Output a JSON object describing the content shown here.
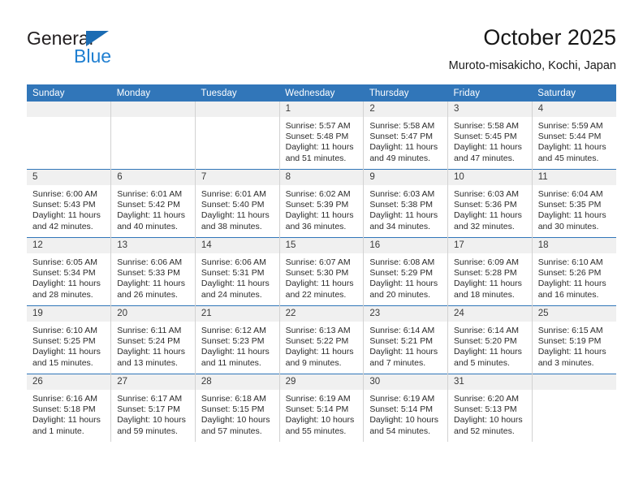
{
  "brand": {
    "name_part1": "General",
    "name_part2": "Blue",
    "triangle_color": "#1b6cb3",
    "blue_color": "#1f7fd1"
  },
  "header": {
    "title": "October 2025",
    "location": "Muroto-misakicho, Kochi, Japan"
  },
  "theme": {
    "header_bar": "#3176b9",
    "daynum_band": "#f0f0f0",
    "cell_border": "#d2d2d2"
  },
  "weekday_headers": [
    "Sunday",
    "Monday",
    "Tuesday",
    "Wednesday",
    "Thursday",
    "Friday",
    "Saturday"
  ],
  "weeks": [
    [
      {
        "day": "",
        "empty": true,
        "lines": []
      },
      {
        "day": "",
        "empty": true,
        "lines": []
      },
      {
        "day": "",
        "empty": true,
        "lines": []
      },
      {
        "day": "1",
        "lines": [
          "Sunrise: 5:57 AM",
          "Sunset: 5:48 PM",
          "Daylight: 11 hours",
          "and 51 minutes."
        ]
      },
      {
        "day": "2",
        "lines": [
          "Sunrise: 5:58 AM",
          "Sunset: 5:47 PM",
          "Daylight: 11 hours",
          "and 49 minutes."
        ]
      },
      {
        "day": "3",
        "lines": [
          "Sunrise: 5:58 AM",
          "Sunset: 5:45 PM",
          "Daylight: 11 hours",
          "and 47 minutes."
        ]
      },
      {
        "day": "4",
        "lines": [
          "Sunrise: 5:59 AM",
          "Sunset: 5:44 PM",
          "Daylight: 11 hours",
          "and 45 minutes."
        ]
      }
    ],
    [
      {
        "day": "5",
        "lines": [
          "Sunrise: 6:00 AM",
          "Sunset: 5:43 PM",
          "Daylight: 11 hours",
          "and 42 minutes."
        ]
      },
      {
        "day": "6",
        "lines": [
          "Sunrise: 6:01 AM",
          "Sunset: 5:42 PM",
          "Daylight: 11 hours",
          "and 40 minutes."
        ]
      },
      {
        "day": "7",
        "lines": [
          "Sunrise: 6:01 AM",
          "Sunset: 5:40 PM",
          "Daylight: 11 hours",
          "and 38 minutes."
        ]
      },
      {
        "day": "8",
        "lines": [
          "Sunrise: 6:02 AM",
          "Sunset: 5:39 PM",
          "Daylight: 11 hours",
          "and 36 minutes."
        ]
      },
      {
        "day": "9",
        "lines": [
          "Sunrise: 6:03 AM",
          "Sunset: 5:38 PM",
          "Daylight: 11 hours",
          "and 34 minutes."
        ]
      },
      {
        "day": "10",
        "lines": [
          "Sunrise: 6:03 AM",
          "Sunset: 5:36 PM",
          "Daylight: 11 hours",
          "and 32 minutes."
        ]
      },
      {
        "day": "11",
        "lines": [
          "Sunrise: 6:04 AM",
          "Sunset: 5:35 PM",
          "Daylight: 11 hours",
          "and 30 minutes."
        ]
      }
    ],
    [
      {
        "day": "12",
        "lines": [
          "Sunrise: 6:05 AM",
          "Sunset: 5:34 PM",
          "Daylight: 11 hours",
          "and 28 minutes."
        ]
      },
      {
        "day": "13",
        "lines": [
          "Sunrise: 6:06 AM",
          "Sunset: 5:33 PM",
          "Daylight: 11 hours",
          "and 26 minutes."
        ]
      },
      {
        "day": "14",
        "lines": [
          "Sunrise: 6:06 AM",
          "Sunset: 5:31 PM",
          "Daylight: 11 hours",
          "and 24 minutes."
        ]
      },
      {
        "day": "15",
        "lines": [
          "Sunrise: 6:07 AM",
          "Sunset: 5:30 PM",
          "Daylight: 11 hours",
          "and 22 minutes."
        ]
      },
      {
        "day": "16",
        "lines": [
          "Sunrise: 6:08 AM",
          "Sunset: 5:29 PM",
          "Daylight: 11 hours",
          "and 20 minutes."
        ]
      },
      {
        "day": "17",
        "lines": [
          "Sunrise: 6:09 AM",
          "Sunset: 5:28 PM",
          "Daylight: 11 hours",
          "and 18 minutes."
        ]
      },
      {
        "day": "18",
        "lines": [
          "Sunrise: 6:10 AM",
          "Sunset: 5:26 PM",
          "Daylight: 11 hours",
          "and 16 minutes."
        ]
      }
    ],
    [
      {
        "day": "19",
        "lines": [
          "Sunrise: 6:10 AM",
          "Sunset: 5:25 PM",
          "Daylight: 11 hours",
          "and 15 minutes."
        ]
      },
      {
        "day": "20",
        "lines": [
          "Sunrise: 6:11 AM",
          "Sunset: 5:24 PM",
          "Daylight: 11 hours",
          "and 13 minutes."
        ]
      },
      {
        "day": "21",
        "lines": [
          "Sunrise: 6:12 AM",
          "Sunset: 5:23 PM",
          "Daylight: 11 hours",
          "and 11 minutes."
        ]
      },
      {
        "day": "22",
        "lines": [
          "Sunrise: 6:13 AM",
          "Sunset: 5:22 PM",
          "Daylight: 11 hours",
          "and 9 minutes."
        ]
      },
      {
        "day": "23",
        "lines": [
          "Sunrise: 6:14 AM",
          "Sunset: 5:21 PM",
          "Daylight: 11 hours",
          "and 7 minutes."
        ]
      },
      {
        "day": "24",
        "lines": [
          "Sunrise: 6:14 AM",
          "Sunset: 5:20 PM",
          "Daylight: 11 hours",
          "and 5 minutes."
        ]
      },
      {
        "day": "25",
        "lines": [
          "Sunrise: 6:15 AM",
          "Sunset: 5:19 PM",
          "Daylight: 11 hours",
          "and 3 minutes."
        ]
      }
    ],
    [
      {
        "day": "26",
        "lines": [
          "Sunrise: 6:16 AM",
          "Sunset: 5:18 PM",
          "Daylight: 11 hours",
          "and 1 minute."
        ]
      },
      {
        "day": "27",
        "lines": [
          "Sunrise: 6:17 AM",
          "Sunset: 5:17 PM",
          "Daylight: 10 hours",
          "and 59 minutes."
        ]
      },
      {
        "day": "28",
        "lines": [
          "Sunrise: 6:18 AM",
          "Sunset: 5:15 PM",
          "Daylight: 10 hours",
          "and 57 minutes."
        ]
      },
      {
        "day": "29",
        "lines": [
          "Sunrise: 6:19 AM",
          "Sunset: 5:14 PM",
          "Daylight: 10 hours",
          "and 55 minutes."
        ]
      },
      {
        "day": "30",
        "lines": [
          "Sunrise: 6:19 AM",
          "Sunset: 5:14 PM",
          "Daylight: 10 hours",
          "and 54 minutes."
        ]
      },
      {
        "day": "31",
        "lines": [
          "Sunrise: 6:20 AM",
          "Sunset: 5:13 PM",
          "Daylight: 10 hours",
          "and 52 minutes."
        ]
      },
      {
        "day": "",
        "empty": true,
        "lines": []
      }
    ]
  ]
}
